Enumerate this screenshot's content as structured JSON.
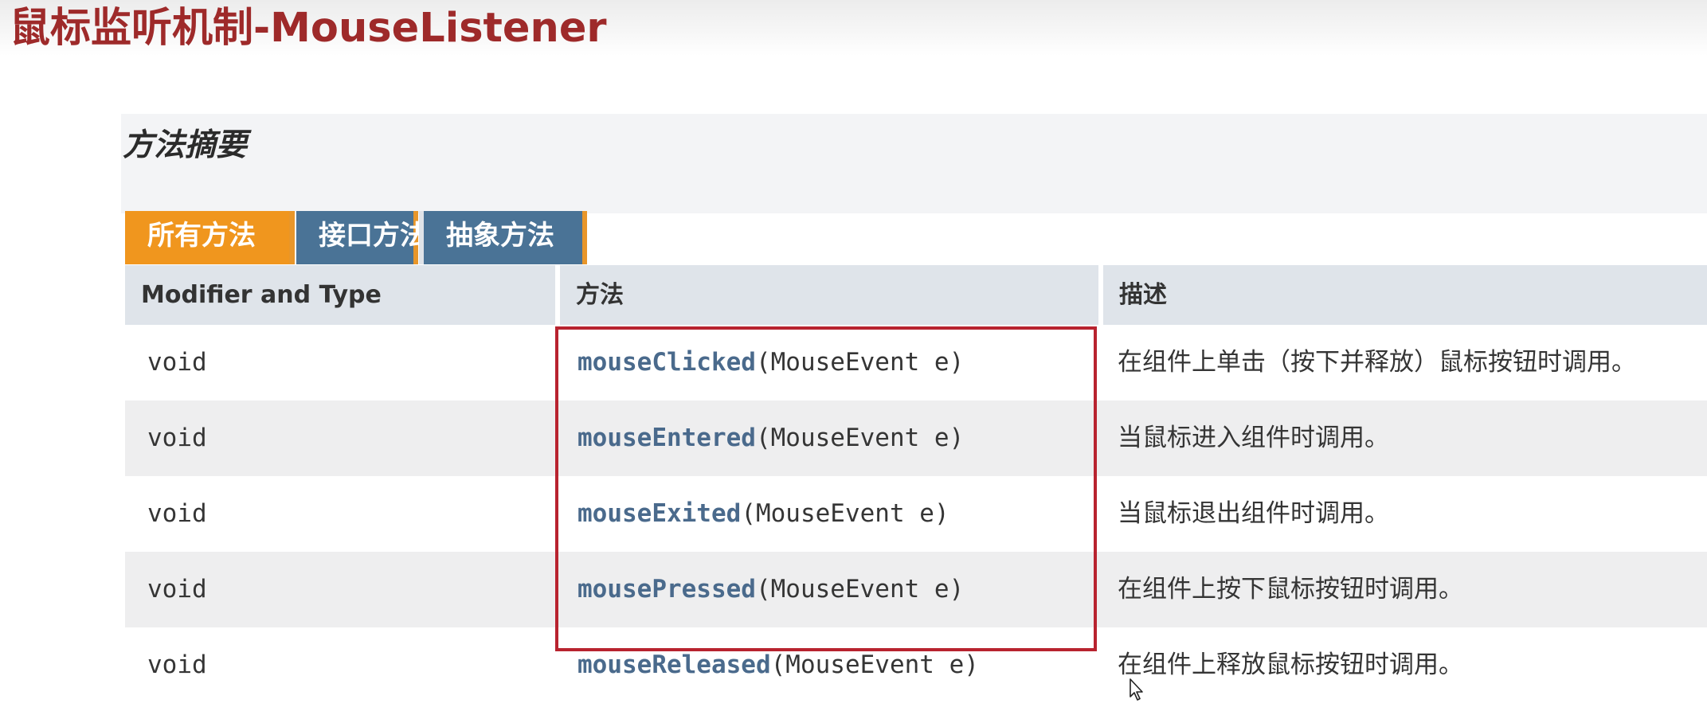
{
  "slide": {
    "title": "鼠标监听机制-MouseListener"
  },
  "summary": {
    "section_title": "方法摘要",
    "tabs": [
      {
        "label": "所有方法",
        "active": true
      },
      {
        "label": "接口方法",
        "active": false
      },
      {
        "label": "抽象方法",
        "active": false
      }
    ],
    "columns": {
      "type": "Modifier and Type",
      "method": "方法",
      "description": "描述"
    },
    "rows": [
      {
        "type": "void",
        "method_name": "mouseClicked",
        "method_params": "(MouseEvent e)",
        "description": "在组件上单击（按下并释放）鼠标按钮时调用。"
      },
      {
        "type": "void",
        "method_name": "mouseEntered",
        "method_params": "(MouseEvent e)",
        "description": "当鼠标进入组件时调用。"
      },
      {
        "type": "void",
        "method_name": "mouseExited",
        "method_params": "(MouseEvent e)",
        "description": "当鼠标退出组件时调用。"
      },
      {
        "type": "void",
        "method_name": "mousePressed",
        "method_params": "(MouseEvent e)",
        "description": "在组件上按下鼠标按钮时调用。"
      },
      {
        "type": "void",
        "method_name": "mouseReleased",
        "method_params": "(MouseEvent e)",
        "description": "在组件上释放鼠标按钮时调用。"
      }
    ]
  },
  "colors": {
    "title": "#9e2a2a",
    "tab_active": "#f0961e",
    "tab_inactive": "#4a7396",
    "method_link": "#4a6a8c",
    "highlight_box": "#b8232f"
  },
  "icons": {
    "cursor": "mouse-pointer-icon"
  }
}
